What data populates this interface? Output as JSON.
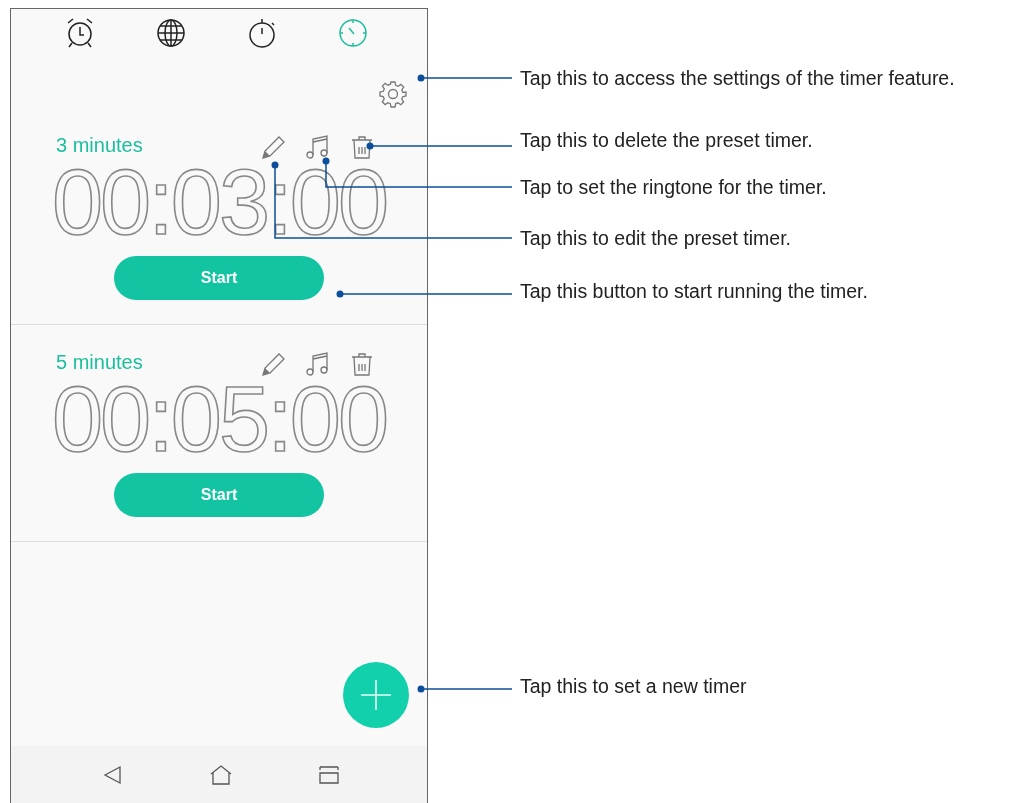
{
  "tabs": [
    {
      "selected": false
    },
    {
      "selected": false
    },
    {
      "selected": false
    },
    {
      "selected": true
    }
  ],
  "timers": [
    {
      "label": "3 minutes",
      "time": "00:03:00",
      "button": "Start"
    },
    {
      "label": "5 minutes",
      "time": "00:05:00",
      "button": "Start"
    }
  ],
  "callouts": [
    {
      "text": "Tap this to access the settings of the timer feature."
    },
    {
      "text": "Tap this to delete the preset timer."
    },
    {
      "text": "Tap to set the ringtone for the timer."
    },
    {
      "text": "Tap this to edit the preset timer."
    },
    {
      "text": "Tap this button to start running the timer."
    },
    {
      "text": "Tap this to set a new timer"
    }
  ]
}
